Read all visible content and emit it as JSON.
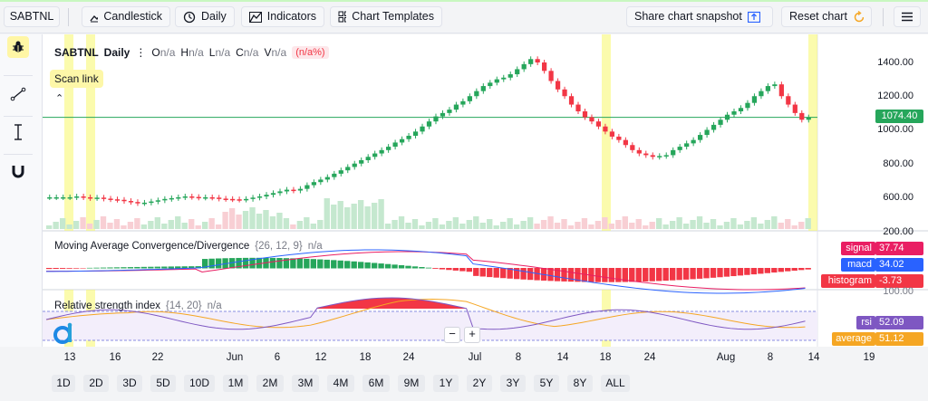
{
  "toolbar": {
    "symbol": "SABTNL",
    "chart_type": "Candlestick",
    "interval": "Daily",
    "indicators": "Indicators",
    "templates": "Chart Templates",
    "snapshot": "Share chart snapshot",
    "reset": "Reset chart"
  },
  "legend": {
    "symbol": "SABTNL",
    "interval": "Daily",
    "o_label": "O",
    "o_val": "n/a",
    "h_label": "H",
    "h_val": "n/a",
    "l_label": "L",
    "l_val": "n/a",
    "c_label": "C",
    "c_val": "n/a",
    "v_label": "V",
    "v_val": "n/a",
    "change": "(n/a%)"
  },
  "scan_link": "Scan link",
  "price_axis": [
    "1400.00",
    "1200.00",
    "1000.00",
    "800.00",
    "600.00",
    "200.00"
  ],
  "last_price": "1074.40",
  "macd": {
    "title": "Moving Average Convergence/Divergence",
    "params": "{26, 12, 9}",
    "value": "n/a",
    "signal_label": "signal",
    "signal_val": "37.74",
    "macd_label": "macd",
    "macd_val": "34.02",
    "hist_label": "histogram",
    "hist_val": "-3.73"
  },
  "rsi": {
    "title": "Relative strength index",
    "params": "{14, 20}",
    "value": "n/a",
    "axis_top": "100.00",
    "rsi_label": "rsi",
    "rsi_val": "52.09",
    "avg_label": "average",
    "avg_val": "51.12"
  },
  "dates": [
    "13",
    "16",
    "22",
    "Jun",
    "6",
    "12",
    "18",
    "24",
    "Jul",
    "8",
    "14",
    "18",
    "24",
    "Aug",
    "8",
    "14",
    "19"
  ],
  "ranges": [
    "1D",
    "2D",
    "3D",
    "5D",
    "10D",
    "1M",
    "2M",
    "3M",
    "4M",
    "6M",
    "9M",
    "1Y",
    "2Y",
    "3Y",
    "5Y",
    "8Y",
    "ALL"
  ],
  "zoom": {
    "minus": "−",
    "plus": "+"
  },
  "colors": {
    "up": "#26a65b",
    "down": "#f23645",
    "highlight": "#f7f76a",
    "macd": "#2962ff",
    "signal": "#e91e63",
    "rsi": "#7e57c2",
    "avg": "#f5a623"
  },
  "chart_data": {
    "type": "candlestick",
    "x_ticks": [
      "13",
      "16",
      "22",
      "Jun",
      "6",
      "12",
      "18",
      "24",
      "Jul",
      "8",
      "14",
      "18",
      "24",
      "Aug",
      "8",
      "14",
      "19"
    ],
    "y_ticks": [
      1400,
      1200,
      1000,
      800,
      600,
      200
    ],
    "last_price": 1074.4,
    "close": [
      600,
      600,
      600,
      600,
      605,
      600,
      595,
      598,
      592,
      588,
      585,
      578,
      572,
      565,
      568,
      575,
      582,
      590,
      595,
      600,
      605,
      602,
      598,
      600,
      598,
      592,
      590,
      588,
      586,
      590,
      598,
      605,
      615,
      625,
      635,
      645,
      640,
      650,
      672,
      690,
      705,
      720,
      740,
      760,
      780,
      800,
      820,
      840,
      860,
      880,
      900,
      925,
      945,
      965,
      990,
      1020,
      1050,
      1080,
      1100,
      1120,
      1150,
      1170,
      1200,
      1230,
      1260,
      1280,
      1300,
      1310,
      1330,
      1360,
      1390,
      1420,
      1400,
      1350,
      1290,
      1240,
      1200,
      1150,
      1110,
      1075,
      1050,
      1020,
      990,
      960,
      940,
      910,
      880,
      860,
      850,
      840,
      845,
      850,
      880,
      900,
      920,
      940,
      970,
      1000,
      1030,
      1060,
      1090,
      1110,
      1130,
      1160,
      1200,
      1230,
      1260,
      1270,
      1200,
      1150,
      1100,
      1060,
      1074.4
    ]
  }
}
